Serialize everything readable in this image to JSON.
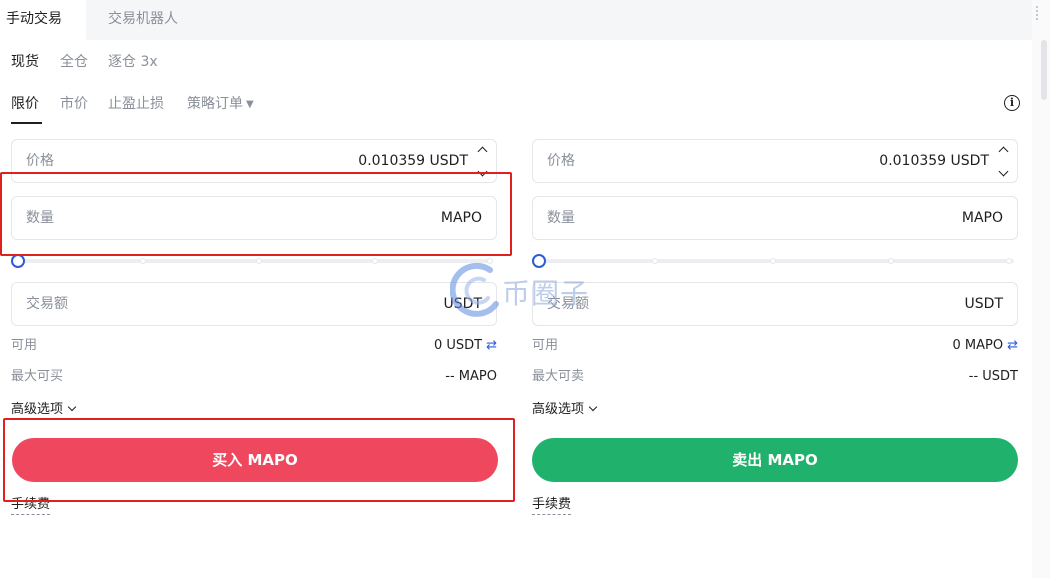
{
  "tabs": {
    "manual": "手动交易",
    "bot": "交易机器人"
  },
  "modes": {
    "spot": "现货",
    "cross": "全仓",
    "isolated": "逐仓 3x"
  },
  "order_tabs": {
    "limit": "限价",
    "market": "市价",
    "tp_sl": "止盈止损",
    "strategy": "策略订单"
  },
  "buy_panel": {
    "price_label": "价格",
    "price_value": "0.010359 USDT",
    "amount_label": "数量",
    "amount_unit": "MAPO",
    "total_label": "交易额",
    "total_unit": "USDT",
    "available_label": "可用",
    "available_value": "0 USDT",
    "max_label": "最大可买",
    "max_value": "-- MAPO",
    "advanced_label": "高级选项",
    "button": "买入 MAPO",
    "fee_label": "手续费"
  },
  "sell_panel": {
    "price_label": "价格",
    "price_value": "0.010359 USDT",
    "amount_label": "数量",
    "amount_unit": "MAPO",
    "total_label": "交易额",
    "total_unit": "USDT",
    "available_label": "可用",
    "available_value": "0 MAPO",
    "max_label": "最大可卖",
    "max_value": "-- USDT",
    "advanced_label": "高级选项",
    "button": "卖出 MAPO",
    "fee_label": "手续费"
  },
  "slider_level": 0,
  "watermark": "币圈子",
  "colors": {
    "buy": "#ef475d",
    "sell": "#20b26c",
    "accent": "#2d5bd8",
    "highlight": "#e02020"
  },
  "icons": {
    "info": "info-icon",
    "swap": "swap-icon",
    "stepper_up": "chevron-up-icon",
    "stepper_down": "chevron-down-icon",
    "dropdown": "caret-down-icon"
  }
}
